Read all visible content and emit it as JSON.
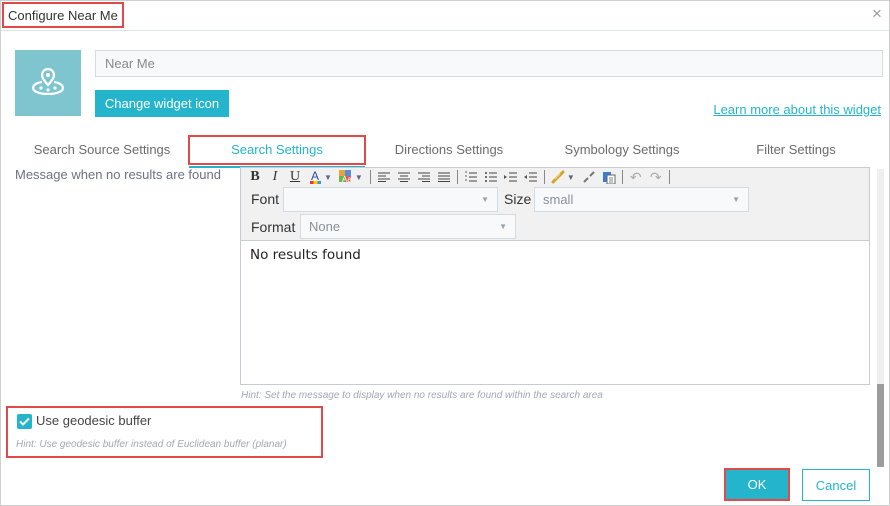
{
  "dialog": {
    "title": "Configure Near Me",
    "close_icon": "close-icon"
  },
  "header": {
    "widget_icon": "map-pin-radius-icon",
    "name_value": "Near Me",
    "change_icon_label": "Change widget icon",
    "learn_more_label": "Learn more about this widget"
  },
  "tabs": [
    {
      "label": "Search Source Settings",
      "active": false
    },
    {
      "label": "Search Settings",
      "active": true
    },
    {
      "label": "Directions Settings",
      "active": false
    },
    {
      "label": "Symbology Settings",
      "active": false
    },
    {
      "label": "Filter Settings",
      "active": false
    }
  ],
  "no_results": {
    "label": "Message when no results are found",
    "editor": {
      "toolbar": {
        "bold": "B",
        "italic": "I",
        "underline": "U",
        "font_color": "A",
        "items": [
          "bold-icon",
          "italic-icon",
          "underline-icon",
          "font-color-icon",
          "highlight-color-icon",
          "align-left-icon",
          "align-center-icon",
          "align-right-icon",
          "align-justify-icon",
          "ordered-list-icon",
          "unordered-list-icon",
          "indent-icon",
          "outdent-icon",
          "link-icon",
          "unlink-icon",
          "paste-icon",
          "undo-icon",
          "redo-icon"
        ]
      },
      "font_label": "Font",
      "font_value": "",
      "size_label": "Size",
      "size_value": "small",
      "format_label": "Format",
      "format_value": "None",
      "content": "No results found"
    },
    "hint": "Hint: Set the message to display when no results are found within the search area"
  },
  "geodesic": {
    "checked": true,
    "label": "Use geodesic buffer",
    "hint": "Hint: Use geodesic buffer instead of Euclidean buffer (planar)"
  },
  "footer": {
    "ok_label": "OK",
    "cancel_label": "Cancel"
  },
  "colors": {
    "accent": "#24b5cc",
    "icon_bg": "#7fc5cf",
    "highlight_border": "#e24a4a"
  }
}
